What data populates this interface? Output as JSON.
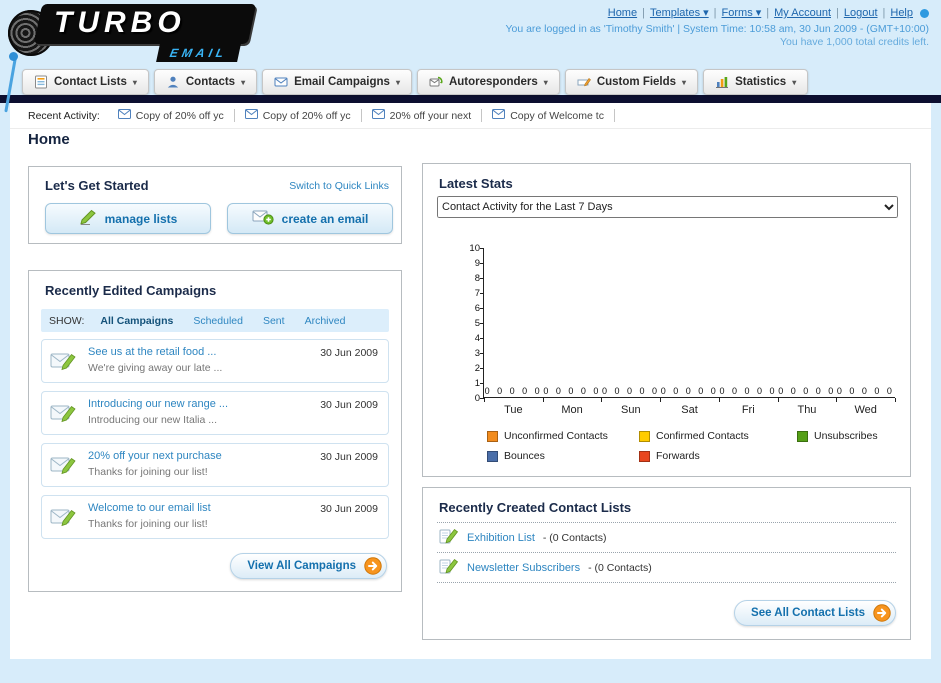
{
  "header": {
    "logo_main": "TURBO",
    "logo_sub": "EMAIL",
    "links": [
      {
        "label": "Home",
        "dropdown": false
      },
      {
        "label": "Templates",
        "dropdown": true
      },
      {
        "label": "Forms",
        "dropdown": true
      },
      {
        "label": "My Account",
        "dropdown": false
      },
      {
        "label": "Logout",
        "dropdown": false
      },
      {
        "label": "Help",
        "dropdown": false
      }
    ],
    "login_info": "You are logged in as 'Timothy Smith' | System Time: 10:58 am, 30 Jun 2009 - (GMT+10:00)",
    "credits_info": "You have 1,000 total credits left."
  },
  "nav": {
    "tabs": [
      {
        "label": "Contact Lists",
        "icon": "contact-lists-icon"
      },
      {
        "label": "Contacts",
        "icon": "contacts-icon"
      },
      {
        "label": "Email Campaigns",
        "icon": "email-campaigns-icon"
      },
      {
        "label": "Autoresponders",
        "icon": "autoresponders-icon"
      },
      {
        "label": "Custom Fields",
        "icon": "custom-fields-icon"
      },
      {
        "label": "Statistics",
        "icon": "statistics-icon"
      }
    ]
  },
  "recent_activity": {
    "label": "Recent Activity:",
    "items": [
      "Copy of 20% off yc",
      "Copy of 20% off yc",
      "20% off your next",
      "Copy of Welcome tc"
    ]
  },
  "page": {
    "title": "Home"
  },
  "get_started": {
    "title": "Let's Get Started",
    "switch_link": "Switch to Quick Links",
    "manage_lists_label": "manage lists",
    "create_email_label": "create an email"
  },
  "campaigns": {
    "title": "Recently Edited Campaigns",
    "show_label": "SHOW:",
    "filters": [
      "All Campaigns",
      "Scheduled",
      "Sent",
      "Archived"
    ],
    "active_filter": "All Campaigns",
    "items": [
      {
        "title": "See us at the retail food ...",
        "subtitle": "We're giving away our late ...",
        "date": "30 Jun 2009"
      },
      {
        "title": "Introducing our new range ...",
        "subtitle": "Introducing our new Italia ...",
        "date": "30 Jun 2009"
      },
      {
        "title": "20% off your next purchase",
        "subtitle": "Thanks for joining our list!",
        "date": "30 Jun 2009"
      },
      {
        "title": "Welcome to our email list",
        "subtitle": "Thanks for joining our list!",
        "date": "30 Jun 2009"
      }
    ],
    "view_all_label": "View All Campaigns"
  },
  "stats": {
    "title": "Latest Stats",
    "selected_option": "Contact Activity for the Last 7 Days"
  },
  "chart_data": {
    "type": "bar",
    "title": "Contact Activity for the Last 7 Days",
    "categories": [
      "Tue",
      "Mon",
      "Sun",
      "Sat",
      "Fri",
      "Thu",
      "Wed"
    ],
    "series": [
      {
        "name": "Unconfirmed Contacts",
        "color": "#f28c1e",
        "values": [
          0,
          0,
          0,
          0,
          0,
          0,
          0
        ]
      },
      {
        "name": "Confirmed Contacts",
        "color": "#ffcc00",
        "values": [
          0,
          0,
          0,
          0,
          0,
          0,
          0
        ]
      },
      {
        "name": "Unsubscribes",
        "color": "#55a017",
        "values": [
          0,
          0,
          0,
          0,
          0,
          0,
          0
        ]
      },
      {
        "name": "Bounces",
        "color": "#4a6ea9",
        "values": [
          0,
          0,
          0,
          0,
          0,
          0,
          0
        ]
      },
      {
        "name": "Forwards",
        "color": "#e8461e",
        "values": [
          0,
          0,
          0,
          0,
          0,
          0,
          0
        ]
      }
    ],
    "xlabel": "",
    "ylabel": "",
    "ylim": [
      0,
      10
    ],
    "yticks": [
      0,
      1,
      2,
      3,
      4,
      5,
      6,
      7,
      8,
      9,
      10
    ],
    "grid": false,
    "legend_position": "bottom"
  },
  "contact_lists": {
    "title": "Recently Created Contact Lists",
    "items": [
      {
        "name": "Exhibition List",
        "suffix": "- (0 Contacts)"
      },
      {
        "name": "Newsletter Subscribers",
        "suffix": "- (0 Contacts)"
      }
    ],
    "see_all_label": "See All Contact Lists"
  }
}
